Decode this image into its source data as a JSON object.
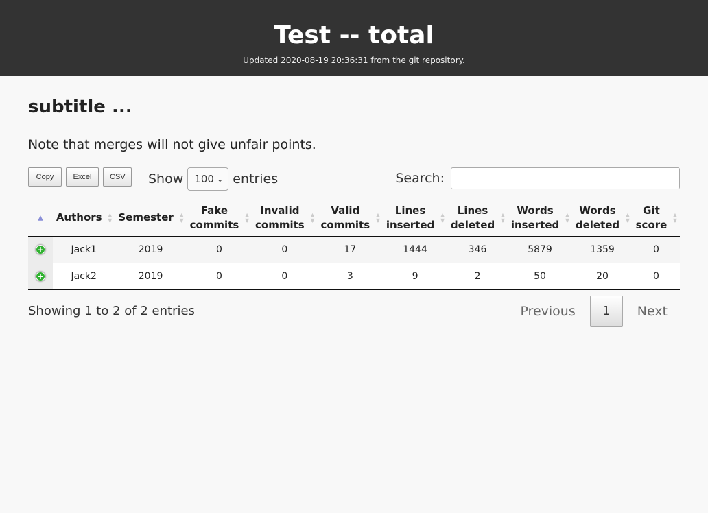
{
  "header": {
    "title": "Test -- total",
    "updated": "Updated 2020-08-19 20:36:31 from the git repository."
  },
  "subtitle": "subtitle ...",
  "note": "Note that merges will not give unfair points.",
  "toolbar": {
    "buttons": [
      "Copy",
      "Excel",
      "CSV"
    ],
    "show_label": "Show",
    "show_value": "100",
    "entries_label": "entries",
    "search_label": "Search:",
    "search_value": ""
  },
  "table": {
    "columns": [
      {
        "line1": "Authors",
        "line2": ""
      },
      {
        "line1": "Semester",
        "line2": ""
      },
      {
        "line1": "Fake",
        "line2": "commits"
      },
      {
        "line1": "Invalid",
        "line2": "commits"
      },
      {
        "line1": "Valid",
        "line2": "commits"
      },
      {
        "line1": "Lines",
        "line2": "inserted"
      },
      {
        "line1": "Lines",
        "line2": "deleted"
      },
      {
        "line1": "Words",
        "line2": "inserted"
      },
      {
        "line1": "Words",
        "line2": "deleted"
      },
      {
        "line1": "Git",
        "line2": "score"
      }
    ],
    "rows": [
      [
        "Jack1",
        "2019",
        "0",
        "0",
        "17",
        "1444",
        "346",
        "5879",
        "1359",
        "0"
      ],
      [
        "Jack2",
        "2019",
        "0",
        "0",
        "3",
        "9",
        "2",
        "50",
        "20",
        "0"
      ]
    ]
  },
  "footer": {
    "info": "Showing 1 to 2 of 2 entries",
    "previous": "Previous",
    "page": "1",
    "next": "Next"
  },
  "colors": {
    "header_bg": "#333333",
    "expand_icon": "#31b131",
    "sort_active": "#8a8fd8"
  }
}
